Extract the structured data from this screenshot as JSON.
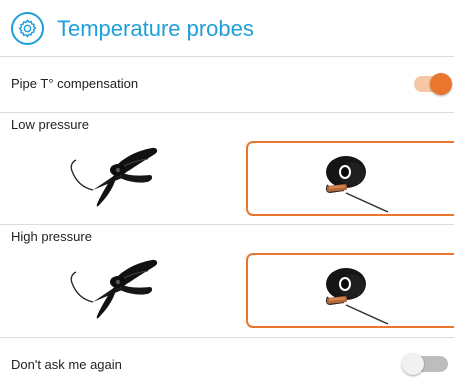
{
  "header": {
    "title": "Temperature probes",
    "icon": "gear-icon"
  },
  "compensation": {
    "label": "Pipe T° compensation",
    "enabled": true
  },
  "low_pressure": {
    "label": "Low pressure",
    "options": [
      {
        "name": "clamp-probe",
        "icon": "clamp-probe-icon",
        "selected": false
      },
      {
        "name": "wrap-probe",
        "icon": "wrap-probe-icon",
        "selected": true
      }
    ]
  },
  "high_pressure": {
    "label": "High pressure",
    "options": [
      {
        "name": "clamp-probe",
        "icon": "clamp-probe-icon",
        "selected": false
      },
      {
        "name": "wrap-probe",
        "icon": "wrap-probe-icon",
        "selected": true
      }
    ]
  },
  "dont_ask": {
    "label": "Don't ask me again",
    "enabled": false
  },
  "colors": {
    "accent_blue": "#1e9fda",
    "accent_orange": "#e8762d",
    "toggle_on_track": "#f5c7a4",
    "toggle_off_track": "#bdbdbd",
    "toggle_off_knob": "#f1f1f1"
  }
}
